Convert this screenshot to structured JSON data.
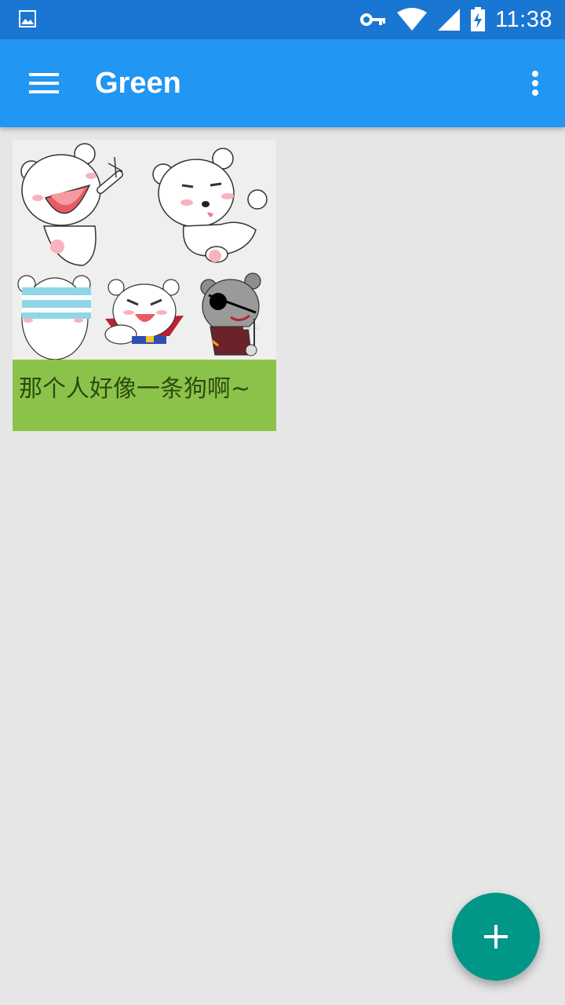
{
  "status_bar": {
    "time": "11:38",
    "icons": [
      "gallery-notification-icon",
      "vpn-key-icon",
      "wifi-icon",
      "signal-icon",
      "battery-charging-icon"
    ]
  },
  "app_bar": {
    "title": "Green",
    "nav_icon": "menu-icon",
    "overflow_icon": "more-vert-icon"
  },
  "cards": [
    {
      "caption": "那个人好像一条狗啊~",
      "image": "sticker-collage-image"
    }
  ],
  "fab": {
    "icon": "add-icon"
  },
  "colors": {
    "status_bar": "#1976d2",
    "app_bar": "#2196f3",
    "background": "#e6e6e6",
    "card_caption_bg": "#8bc34a",
    "fab": "#009688"
  }
}
